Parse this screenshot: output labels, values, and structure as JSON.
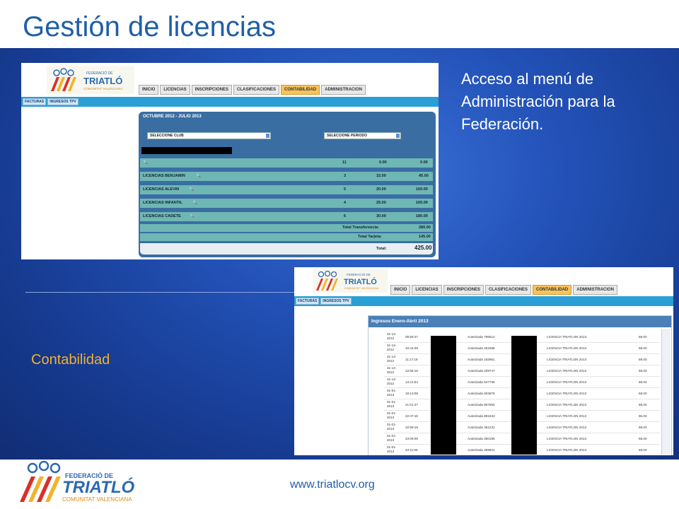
{
  "slide": {
    "title": "Gestión de licencias",
    "right_text": "Acceso al menú de Administración para la Federación.",
    "contabilidad_label": "Contabilidad",
    "footer_url": "www.triatlocv.org"
  },
  "nav": {
    "tabs": [
      "INICIO",
      "LICENCIAS",
      "INSCRIPCIONES",
      "CLASIFICACIONES",
      "CONTABILIDAD",
      "ADMINISTRACION"
    ],
    "active_tab": "CONTABILIDAD",
    "subtabs": [
      "FACTURAS",
      "INGRESOS TPV"
    ]
  },
  "logo": {
    "line1": "FEDERACIÓ DE",
    "line2": "TRIATLÓ",
    "line3": "COMUNITAT VALENCIANA"
  },
  "licencias_panel": {
    "title": "OCTUBRE 2012 - JULIO 2013",
    "select_club": "SELECCIONE CLUB",
    "select_periodo": "SELECCIONE PERIODO",
    "rows": [
      {
        "label": "",
        "count": "11",
        "price": "0.00",
        "total": "0.00"
      },
      {
        "label": "LICENCIAS BENJAMIN",
        "count": "3",
        "price": "15.00",
        "total": "45.00"
      },
      {
        "label": "LICENCIAS ALEVIN",
        "count": "5",
        "price": "20.00",
        "total": "100.00"
      },
      {
        "label": "LICENCIAS INFANTIL",
        "count": "4",
        "price": "25.00",
        "total": "100.00"
      },
      {
        "label": "LICENCIAS CADETE",
        "count": "6",
        "price": "30.00",
        "total": "180.00"
      }
    ],
    "totals": {
      "transferencia_label": "Total Transferencia:",
      "transferencia_value": "280.00",
      "tarjeta_label": "Total Tarjeta:",
      "tarjeta_value": "145.00",
      "total_label": "Total:",
      "total_value": "425.00"
    }
  },
  "ingresos_panel": {
    "title": "Ingresos Enero-Abril 2013",
    "rows": [
      {
        "date": "31-12-2012",
        "time": "09:58:47",
        "auth": "Autorizada 795512",
        "concept": "LICENCIA TRIATLON 2013",
        "amount": "68.00"
      },
      {
        "date": "31-12-2012",
        "time": "10:44:09",
        "auth": "Autorizada 451558",
        "concept": "LICENCIA TRIATLON 2013",
        "amount": "68.00"
      },
      {
        "date": "31-12-2012",
        "time": "11:17:19",
        "auth": "Autorizada 182951",
        "concept": "LICENCIA TRIATLON 2013",
        "amount": "68.00"
      },
      {
        "date": "31-12-2012",
        "time": "12:55:16",
        "auth": "Autorizada 209747",
        "concept": "LICENCIA TRIATLON 2013",
        "amount": "68.00"
      },
      {
        "date": "31-12-2012",
        "time": "13:21:54",
        "auth": "Autorizada 547736",
        "concept": "LICENCIA TRIATLON 2013",
        "amount": "68.00"
      },
      {
        "date": "01-01-2013",
        "time": "19:13:08",
        "auth": "Autorizada 903676",
        "concept": "LICENCIA TRIATLON 2013",
        "amount": "68.00"
      },
      {
        "date": "01-01-2013",
        "time": "21:01:47",
        "auth": "Autorizada 967560",
        "concept": "LICENCIA TRIATLON 2013",
        "amount": "68.00"
      },
      {
        "date": "01-01-2013",
        "time": "22:47:18",
        "auth": "Autorizada 881533",
        "concept": "LICENCIA TRIATLON 2013",
        "amount": "85.00"
      },
      {
        "date": "01-01-2013",
        "time": "22:59:19",
        "auth": "Autorizada 351231",
        "concept": "LICENCIA TRIATLON 2013",
        "amount": "68.00"
      },
      {
        "date": "01-01-2013",
        "time": "23:08:05",
        "auth": "Autorizada 350156",
        "concept": "LICENCIA TRIATLON 2013",
        "amount": "68.00"
      },
      {
        "date": "01-01-2013",
        "time": "23:11:55",
        "auth": "Autorizada 359621",
        "concept": "LICENCIA TRIATLON 2013",
        "amount": "68.00"
      }
    ]
  },
  "colors": {
    "title_blue": "#1f5fa6",
    "accent_orange": "#f3b12a",
    "panel_blue": "#3a6ea3",
    "row_teal": "#6fb7b4"
  }
}
